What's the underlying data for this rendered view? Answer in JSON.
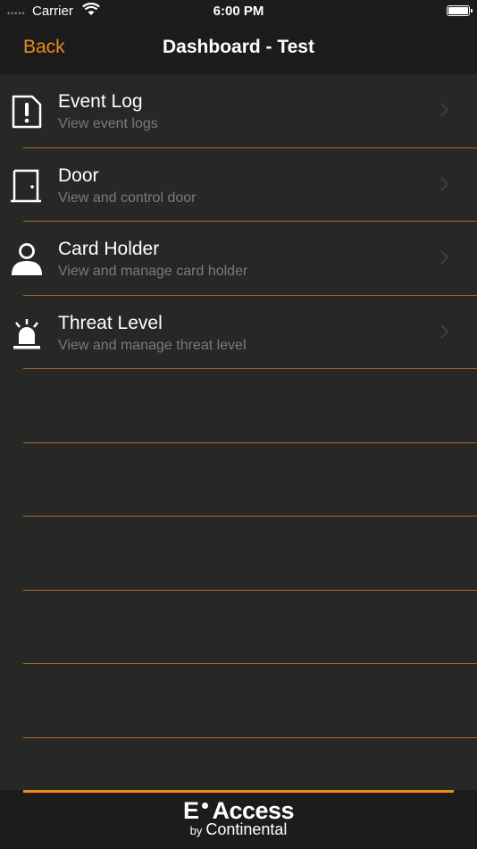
{
  "status_bar": {
    "carrier": "Carrier",
    "time": "6:00 PM",
    "signal_icon": "signal-dots-icon",
    "wifi_icon": "wifi-icon",
    "battery_icon": "battery-icon"
  },
  "nav": {
    "back_label": "Back",
    "title": "Dashboard - Test"
  },
  "menu": {
    "items": [
      {
        "title": "Event Log",
        "subtitle": "View event logs",
        "icon": "alert-document-icon"
      },
      {
        "title": "Door",
        "subtitle": "View and control door",
        "icon": "door-icon"
      },
      {
        "title": "Card Holder",
        "subtitle": "View and manage card holder",
        "icon": "person-icon"
      },
      {
        "title": "Threat Level",
        "subtitle": "View and manage threat level",
        "icon": "siren-icon"
      }
    ]
  },
  "footer": {
    "logo_main_left": "E",
    "logo_main_right": "Access",
    "logo_by": "by",
    "logo_company": "Continental"
  },
  "colors": {
    "accent": "#ef8a1c",
    "background": "#272727",
    "bar": "#1c1c1c",
    "separator": "#a86a22",
    "subtitle": "#7a7a7a"
  }
}
